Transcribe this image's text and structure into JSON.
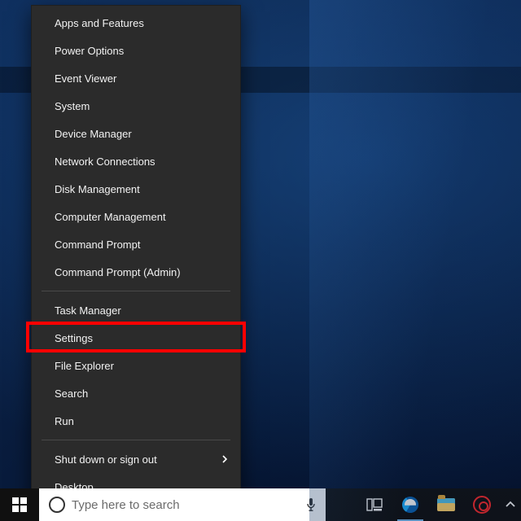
{
  "winx_menu": {
    "groups": [
      {
        "items": [
          {
            "label": "Apps and Features",
            "submenu": false,
            "name": "winx-apps-and-features"
          },
          {
            "label": "Power Options",
            "submenu": false,
            "name": "winx-power-options"
          },
          {
            "label": "Event Viewer",
            "submenu": false,
            "name": "winx-event-viewer"
          },
          {
            "label": "System",
            "submenu": false,
            "name": "winx-system"
          },
          {
            "label": "Device Manager",
            "submenu": false,
            "name": "winx-device-manager"
          },
          {
            "label": "Network Connections",
            "submenu": false,
            "name": "winx-network-connections"
          },
          {
            "label": "Disk Management",
            "submenu": false,
            "name": "winx-disk-management"
          },
          {
            "label": "Computer Management",
            "submenu": false,
            "name": "winx-computer-management"
          },
          {
            "label": "Command Prompt",
            "submenu": false,
            "name": "winx-command-prompt"
          },
          {
            "label": "Command Prompt (Admin)",
            "submenu": false,
            "name": "winx-command-prompt-admin"
          }
        ]
      },
      {
        "items": [
          {
            "label": "Task Manager",
            "submenu": false,
            "name": "winx-task-manager"
          },
          {
            "label": "Settings",
            "submenu": false,
            "name": "winx-settings",
            "highlighted": true
          },
          {
            "label": "File Explorer",
            "submenu": false,
            "name": "winx-file-explorer"
          },
          {
            "label": "Search",
            "submenu": false,
            "name": "winx-search"
          },
          {
            "label": "Run",
            "submenu": false,
            "name": "winx-run"
          }
        ]
      },
      {
        "items": [
          {
            "label": "Shut down or sign out",
            "submenu": true,
            "name": "winx-shutdown-signout"
          },
          {
            "label": "Desktop",
            "submenu": false,
            "name": "winx-desktop"
          }
        ]
      }
    ]
  },
  "taskbar": {
    "search_placeholder": "Type here to search",
    "icons": [
      {
        "name": "task-view-icon"
      },
      {
        "name": "edge-icon"
      },
      {
        "name": "file-explorer-icon"
      },
      {
        "name": "app-gear-red-icon"
      }
    ]
  },
  "colors": {
    "menu_bg": "#2b2b2b",
    "menu_text": "#ffffff",
    "separator": "#4a4a4a",
    "highlight": "#ff0000",
    "taskbar_bg": "#101010"
  }
}
